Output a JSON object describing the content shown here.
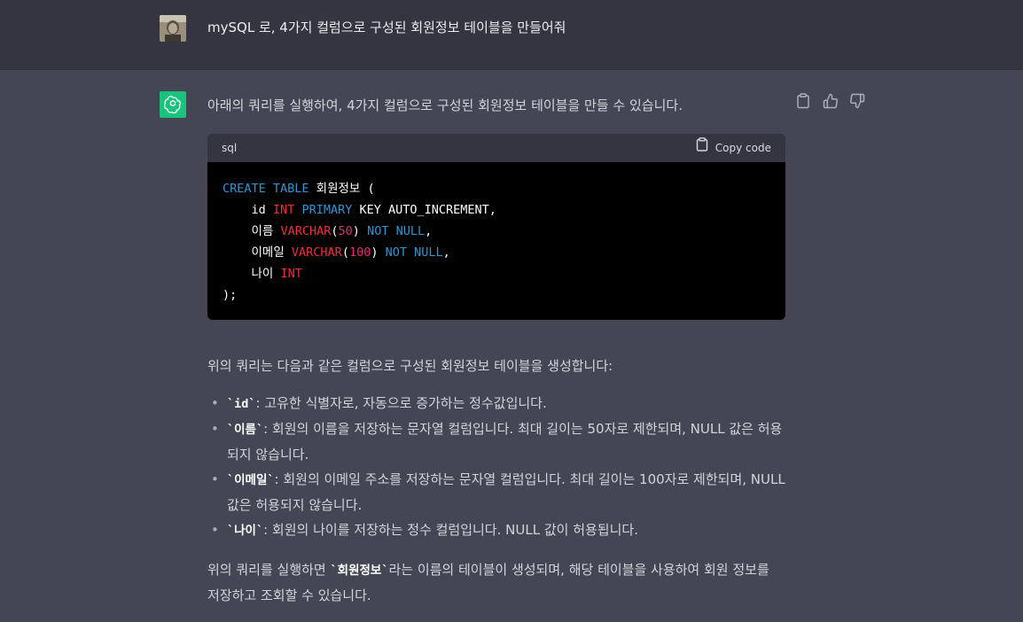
{
  "user": {
    "avatar": "user-avatar",
    "message": "mySQL 로, 4가지 컬럼으로 구성된 회원정보 테이블을 만들어줘"
  },
  "assistant": {
    "avatar": "openai-logo-icon",
    "intro": "아래의 쿼리를 실행하여, 4가지 컬럼으로 구성된 회원정보 테이블을 만들 수 있습니다.",
    "code": {
      "language": "sql",
      "copy_label": "Copy code",
      "lines": [
        [
          {
            "t": "kw",
            "v": "CREATE TABLE"
          },
          {
            "t": "tx",
            "v": " 회원정보 ("
          }
        ],
        [
          {
            "t": "tx",
            "v": "    id "
          },
          {
            "t": "ty",
            "v": "INT"
          },
          {
            "t": "tx",
            "v": " "
          },
          {
            "t": "kw",
            "v": "PRIMARY"
          },
          {
            "t": "tx",
            "v": " KEY AUTO_INCREMENT,"
          }
        ],
        [
          {
            "t": "tx",
            "v": "    이름 "
          },
          {
            "t": "ty",
            "v": "VARCHAR"
          },
          {
            "t": "tx",
            "v": "("
          },
          {
            "t": "num",
            "v": "50"
          },
          {
            "t": "tx",
            "v": ") "
          },
          {
            "t": "kw",
            "v": "NOT NULL"
          },
          {
            "t": "tx",
            "v": ","
          }
        ],
        [
          {
            "t": "tx",
            "v": "    이메일 "
          },
          {
            "t": "ty",
            "v": "VARCHAR"
          },
          {
            "t": "tx",
            "v": "("
          },
          {
            "t": "num",
            "v": "100"
          },
          {
            "t": "tx",
            "v": ") "
          },
          {
            "t": "kw",
            "v": "NOT NULL"
          },
          {
            "t": "tx",
            "v": ","
          }
        ],
        [
          {
            "t": "tx",
            "v": "    나이 "
          },
          {
            "t": "ty",
            "v": "INT"
          }
        ],
        [
          {
            "t": "tx",
            "v": ");"
          }
        ]
      ]
    },
    "para2": "위의 쿼리는 다음과 같은 컬럼으로 구성된 회원정보 테이블을 생성합니다:",
    "bullets": [
      {
        "code": "`id`",
        "text": ": 고유한 식별자로, 자동으로 증가하는 정수값입니다."
      },
      {
        "code": "`이름`",
        "text": ": 회원의 이름을 저장하는 문자열 컬럼입니다. 최대 길이는 50자로 제한되며, NULL 값은 허용되지 않습니다."
      },
      {
        "code": "`이메일`",
        "text": ": 회원의 이메일 주소를 저장하는 문자열 컬럼입니다. 최대 길이는 100자로 제한되며, NULL 값은 허용되지 않습니다."
      },
      {
        "code": "`나이`",
        "text": ": 회원의 나이를 저장하는 정수 컬럼입니다. NULL 값이 허용됩니다."
      }
    ],
    "para3_before": "위의 쿼리를 실행하면 ",
    "para3_code": "`회원정보`",
    "para3_after": "라는 이름의 테이블이 생성되며, 해당 테이블을 사용하여 회원 정보를 저장하고 조회할 수 있습니다.",
    "actions": [
      "clipboard-icon",
      "thumbs-up-icon",
      "thumbs-down-icon"
    ]
  },
  "colors": {
    "user_bg": "#343541",
    "assistant_bg": "#444654",
    "gpt_green": "#19c37d",
    "code_bg": "#000000",
    "keyword": "#2e95d3",
    "type": "#f22c3d",
    "number": "#df3079"
  }
}
